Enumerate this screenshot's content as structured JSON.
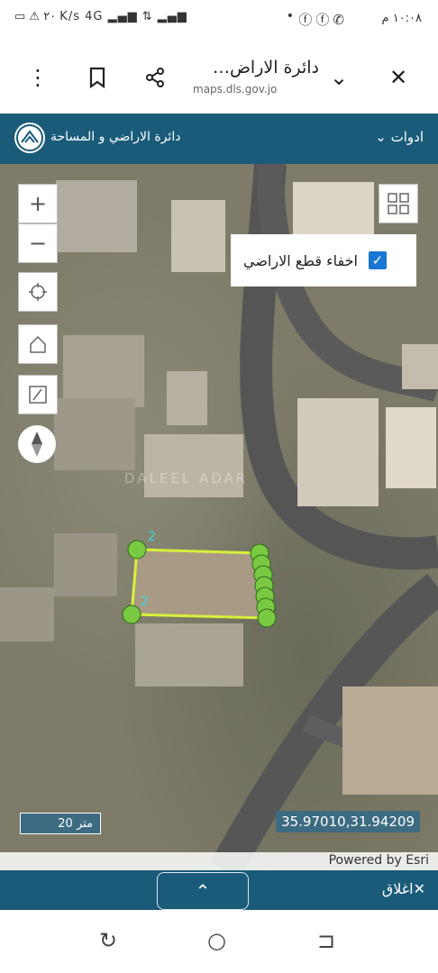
{
  "status": {
    "time": "١٠:٠٨ م",
    "speed_label": "٢٠ K/s",
    "network": "4G"
  },
  "browser": {
    "page_title": "دائرة الاراض…",
    "url": "maps.dls.gov.jo"
  },
  "app": {
    "org_name": "دائرة الاراضي و المساحة",
    "tools_label": "ادوات"
  },
  "map": {
    "hide_parcels_label": "اخفاء قطع الاراضي",
    "hide_parcels_checked": true,
    "scale_label": "20 متر",
    "coordinates": "35.97010,31.94209",
    "attribution": "Powered by Esri",
    "watermark": "DALEEL ADAR",
    "parcel_labels": [
      "2",
      "2"
    ]
  },
  "panel": {
    "close_label": "اغلاق"
  }
}
